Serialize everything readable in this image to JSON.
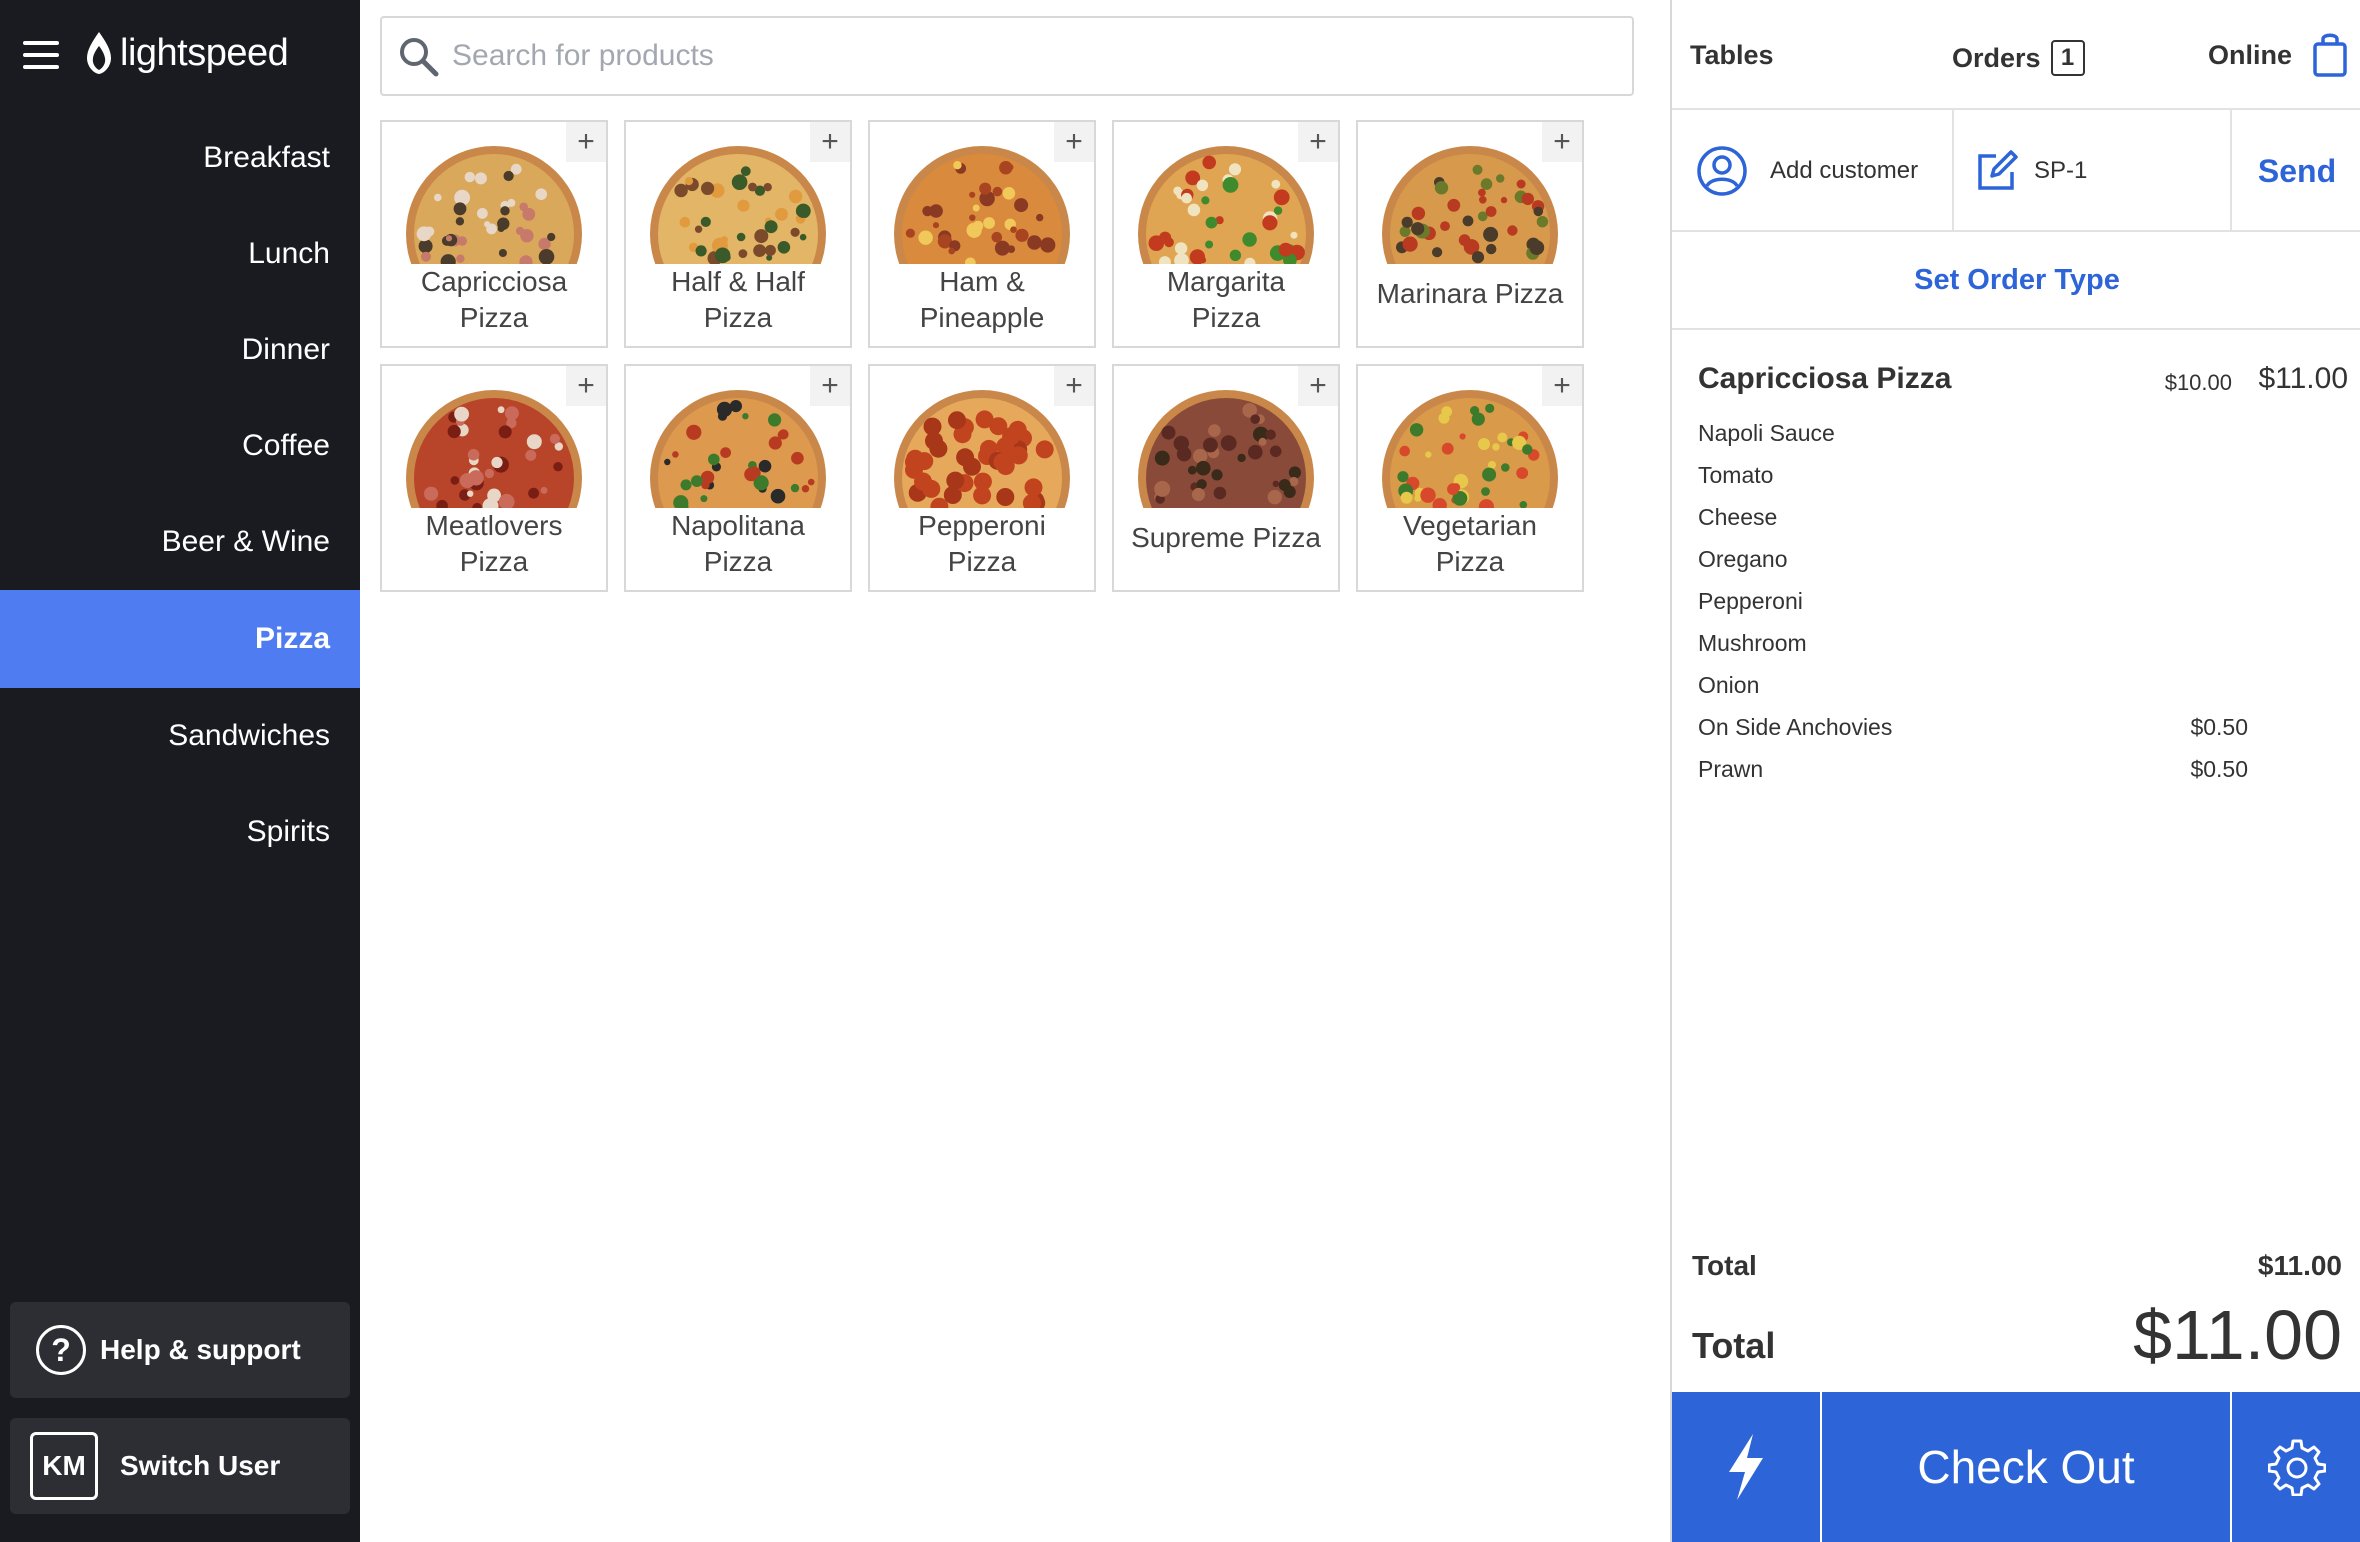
{
  "app": {
    "logo_text": "lightspeed"
  },
  "sidebar": {
    "categories": [
      {
        "label": "Breakfast",
        "active": false
      },
      {
        "label": "Lunch",
        "active": false
      },
      {
        "label": "Dinner",
        "active": false
      },
      {
        "label": "Coffee",
        "active": false
      },
      {
        "label": "Beer & Wine",
        "active": false
      },
      {
        "label": "Pizza",
        "active": true
      },
      {
        "label": "Sandwiches",
        "active": false
      },
      {
        "label": "Spirits",
        "active": false
      }
    ],
    "help_label": "Help & support",
    "help_icon_glyph": "?",
    "user_initials": "KM",
    "switch_user_label": "Switch User"
  },
  "search": {
    "placeholder": "Search for products"
  },
  "products": [
    {
      "name": "Capricciosa Pizza",
      "lines": [
        "Capricciosa",
        "Pizza"
      ],
      "icon": "pizza-capricciosa"
    },
    {
      "name": "Half & Half Pizza",
      "lines": [
        "Half & Half",
        "Pizza"
      ],
      "icon": "pizza-half-half"
    },
    {
      "name": "Ham & Pineapple",
      "lines": [
        "Ham &",
        "Pineapple"
      ],
      "icon": "pizza-ham-pineapple"
    },
    {
      "name": "Margarita Pizza",
      "lines": [
        "Margarita",
        "Pizza"
      ],
      "icon": "pizza-margarita"
    },
    {
      "name": "Marinara Pizza",
      "lines": [
        "Marinara Pizza"
      ],
      "icon": "pizza-marinara"
    },
    {
      "name": "Meatlovers Pizza",
      "lines": [
        "Meatlovers",
        "Pizza"
      ],
      "icon": "pizza-meatlovers"
    },
    {
      "name": "Napolitana Pizza",
      "lines": [
        "Napolitana",
        "Pizza"
      ],
      "icon": "pizza-napolitana"
    },
    {
      "name": "Pepperoni Pizza",
      "lines": [
        "Pepperoni",
        "Pizza"
      ],
      "icon": "pizza-pepperoni"
    },
    {
      "name": "Supreme Pizza",
      "lines": [
        "Supreme Pizza"
      ],
      "icon": "pizza-supreme"
    },
    {
      "name": "Vegetarian Pizza",
      "lines": [
        "Vegetarian",
        "Pizza"
      ],
      "icon": "pizza-vegetarian"
    }
  ],
  "add_glyph": "+",
  "order": {
    "tabs": {
      "tables": "Tables",
      "orders": "Orders",
      "orders_count": "1",
      "online": "Online"
    },
    "add_customer": "Add customer",
    "order_name": "SP-1",
    "send": "Send",
    "set_order_type": "Set Order Type",
    "line_item": {
      "name": "Capricciosa Pizza",
      "unit_price": "$10.00",
      "total": "$11.00",
      "modifiers": [
        {
          "name": "Napoli Sauce",
          "price": ""
        },
        {
          "name": "Tomato",
          "price": ""
        },
        {
          "name": "Cheese",
          "price": ""
        },
        {
          "name": "Oregano",
          "price": ""
        },
        {
          "name": "Pepperoni",
          "price": ""
        },
        {
          "name": "Mushroom",
          "price": ""
        },
        {
          "name": "Onion",
          "price": ""
        },
        {
          "name": "On Side Anchovies",
          "price": "$0.50"
        },
        {
          "name": "Prawn",
          "price": "$0.50"
        }
      ]
    },
    "subtotal_label": "Total",
    "subtotal_value": "$11.00",
    "total_label": "Total",
    "total_value": "$11.00",
    "checkout": "Check Out"
  },
  "colors": {
    "sidebar_bg": "#191b20",
    "accent": "#4f7cf0",
    "primary": "#2d64d8"
  }
}
